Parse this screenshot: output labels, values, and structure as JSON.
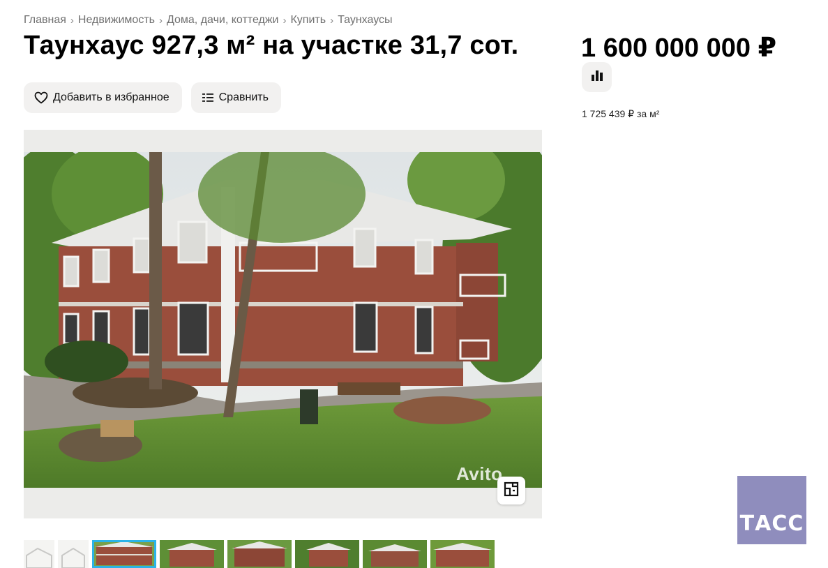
{
  "breadcrumbs": [
    "Главная",
    "Недвижимость",
    "Дома, дачи, коттеджи",
    "Купить",
    "Таунхаусы"
  ],
  "breadcrumb_separator": "›",
  "title": "Таунхаус 927,3 м² на участке 31,7 сот.",
  "actions": {
    "favorite_label": "Добавить в избранное",
    "compare_label": "Сравнить"
  },
  "price": {
    "value": "1 600 000 000 ₽",
    "per_sqm": "1 725 439 ₽ за м²"
  },
  "gallery": {
    "watermark": "Avito",
    "thumbnail_count": 8,
    "active_thumbnail": 3
  },
  "logo": {
    "text": "ТАСС",
    "color": "#8f8dbd"
  },
  "colors": {
    "pill_bg": "#f2f1f0",
    "active_thumb": "#2bb3e8"
  }
}
